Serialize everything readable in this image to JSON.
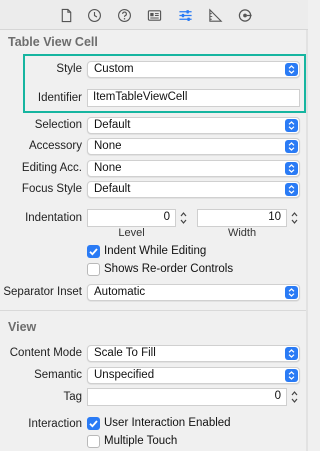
{
  "tabs": [
    {
      "icon": "file-icon"
    },
    {
      "icon": "history-clock-icon"
    },
    {
      "icon": "help-question-icon"
    },
    {
      "icon": "identity-card-icon"
    },
    {
      "icon": "attributes-sliders-icon",
      "selected": true
    },
    {
      "icon": "size-ruler-icon"
    },
    {
      "icon": "connections-arrow-icon"
    }
  ],
  "table_view_cell": {
    "header": "Table View Cell",
    "style_label": "Style",
    "style_value": "Custom",
    "identifier_label": "Identifier",
    "identifier_value": "ItemTableViewCell",
    "selection_label": "Selection",
    "selection_value": "Default",
    "accessory_label": "Accessory",
    "accessory_value": "None",
    "editing_acc_label": "Editing Acc.",
    "editing_acc_value": "None",
    "focus_style_label": "Focus Style",
    "focus_style_value": "Default",
    "indentation_label": "Indentation",
    "indentation_level_value": "0",
    "indentation_width_value": "10",
    "level_sublabel": "Level",
    "width_sublabel": "Width",
    "indent_while_editing_label": "Indent While Editing",
    "indent_while_editing_checked": true,
    "shows_reorder_label": "Shows Re-order Controls",
    "shows_reorder_checked": false,
    "separator_inset_label": "Separator Inset",
    "separator_inset_value": "Automatic"
  },
  "view": {
    "header": "View",
    "content_mode_label": "Content Mode",
    "content_mode_value": "Scale To Fill",
    "semantic_label": "Semantic",
    "semantic_value": "Unspecified",
    "tag_label": "Tag",
    "tag_value": "0",
    "interaction_label": "Interaction",
    "user_interaction_label": "User Interaction Enabled",
    "user_interaction_checked": true,
    "multiple_touch_label": "Multiple Touch",
    "multiple_touch_checked": false
  },
  "colors": {
    "accent": "#2a7bf5",
    "highlight_border": "#16b5a0",
    "panel_bg": "#f0f0f0"
  }
}
